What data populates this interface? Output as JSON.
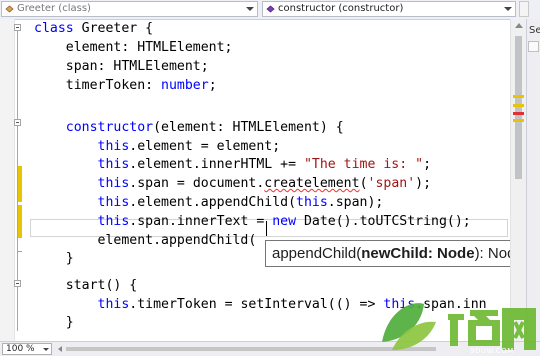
{
  "navbar": {
    "type_combo": "Greeter (class)",
    "member_combo": "constructor (constructor)"
  },
  "editor": {
    "lines": [
      [
        {
          "t": "class",
          "c": "kw"
        },
        {
          "t": " Greeter {",
          "c": ""
        }
      ],
      [
        {
          "t": "    element: HTMLElement;",
          "c": ""
        }
      ],
      [
        {
          "t": "    span: HTMLElement;",
          "c": ""
        }
      ],
      [
        {
          "t": "    timerToken: ",
          "c": ""
        },
        {
          "t": "number",
          "c": "kw"
        },
        {
          "t": ";",
          "c": ""
        }
      ],
      [],
      [
        {
          "t": "    ",
          "c": ""
        },
        {
          "t": "constructor",
          "c": "kw"
        },
        {
          "t": "(element: HTMLElement) {",
          "c": ""
        }
      ],
      [
        {
          "t": "        ",
          "c": ""
        },
        {
          "t": "this",
          "c": "kw"
        },
        {
          "t": ".element = element;",
          "c": ""
        }
      ],
      [
        {
          "t": "        ",
          "c": ""
        },
        {
          "t": "this",
          "c": "kw"
        },
        {
          "t": ".element.innerHTML += ",
          "c": ""
        },
        {
          "t": "\"The time is: \"",
          "c": "str"
        },
        {
          "t": ";",
          "c": ""
        }
      ],
      [
        {
          "t": "        ",
          "c": ""
        },
        {
          "t": "this",
          "c": "kw"
        },
        {
          "t": ".span = document.",
          "c": ""
        },
        {
          "t": "createlement",
          "c": "squiggle"
        },
        {
          "t": "(",
          "c": ""
        },
        {
          "t": "'span'",
          "c": "str"
        },
        {
          "t": ");",
          "c": ""
        }
      ],
      [
        {
          "t": "        ",
          "c": ""
        },
        {
          "t": "this",
          "c": "kw"
        },
        {
          "t": ".element.appendChild(",
          "c": ""
        },
        {
          "t": "this",
          "c": "kw"
        },
        {
          "t": ".span);",
          "c": ""
        }
      ],
      [
        {
          "t": "        ",
          "c": ""
        },
        {
          "t": "this",
          "c": "kw"
        },
        {
          "t": ".span.innerText = ",
          "c": ""
        },
        {
          "t": "new",
          "c": "kw"
        },
        {
          "t": " Date().toUTCString();",
          "c": ""
        }
      ],
      [
        {
          "t": "        element.appendChild(",
          "c": ""
        }
      ],
      [
        {
          "t": "    }",
          "c": ""
        }
      ],
      [],
      [
        {
          "t": "    start() {",
          "c": ""
        }
      ],
      [
        {
          "t": "        ",
          "c": ""
        },
        {
          "t": "this",
          "c": "kw"
        },
        {
          "t": ".timerToken = setInterval(() =",
          "c": ""
        },
        {
          "t": "> ",
          "c": ""
        },
        {
          "t": "this",
          "c": "kw"
        },
        {
          "t": ".span.inn",
          "c": ""
        }
      ],
      [
        {
          "t": "    }",
          "c": ""
        }
      ]
    ]
  },
  "signature_help": {
    "method": "appendChild(",
    "param": "newChild: Node",
    "suffix": "): Node"
  },
  "sidebar": {
    "tab_label": "Se"
  },
  "statusbar": {
    "zoom": "100 %"
  },
  "watermark": {
    "brand": "九度网",
    "url": "9DUW.COM"
  },
  "colors": {
    "keyword": "#0000ff",
    "string": "#a31515",
    "change_marker": "#e9c400",
    "error": "#ff2a2a"
  }
}
